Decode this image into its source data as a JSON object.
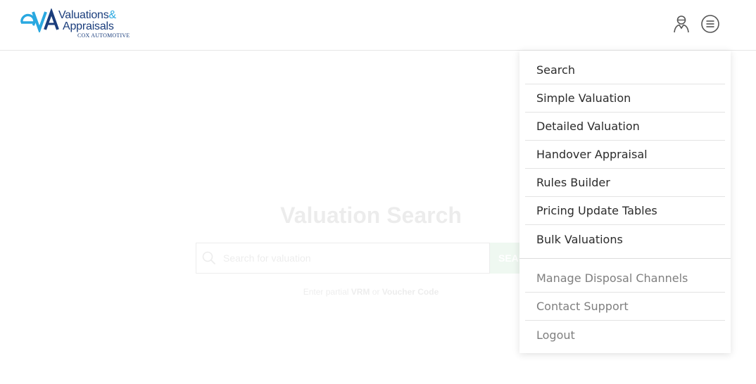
{
  "brand": {
    "mark": "eVA",
    "line1": "Valuations",
    "ampersand": "&",
    "line2": "Appraisals",
    "subline": "COX AUTOMOTIVE",
    "colors": {
      "light_blue": "#29a8e0",
      "navy": "#1a3d7c"
    }
  },
  "header": {
    "icons": [
      "user-icon",
      "menu-icon"
    ]
  },
  "background": {
    "title": "Valuation Search",
    "search_placeholder": "Search for valuation",
    "search_button": "SEARCH",
    "hint_prefix": "Enter partial",
    "hint_vrm": "VRM",
    "hint_or": "or",
    "hint_voucher": "Voucher Code"
  },
  "menu": {
    "primary": [
      {
        "label": "Search"
      },
      {
        "label": "Simple Valuation"
      },
      {
        "label": "Detailed Valuation"
      },
      {
        "label": "Handover Appraisal"
      },
      {
        "label": "Rules Builder"
      },
      {
        "label": "Pricing Update Tables"
      },
      {
        "label": "Bulk Valuations"
      }
    ],
    "secondary": [
      {
        "label": "Manage Disposal Channels"
      },
      {
        "label": "Contact Support"
      },
      {
        "label": "Logout"
      }
    ]
  }
}
